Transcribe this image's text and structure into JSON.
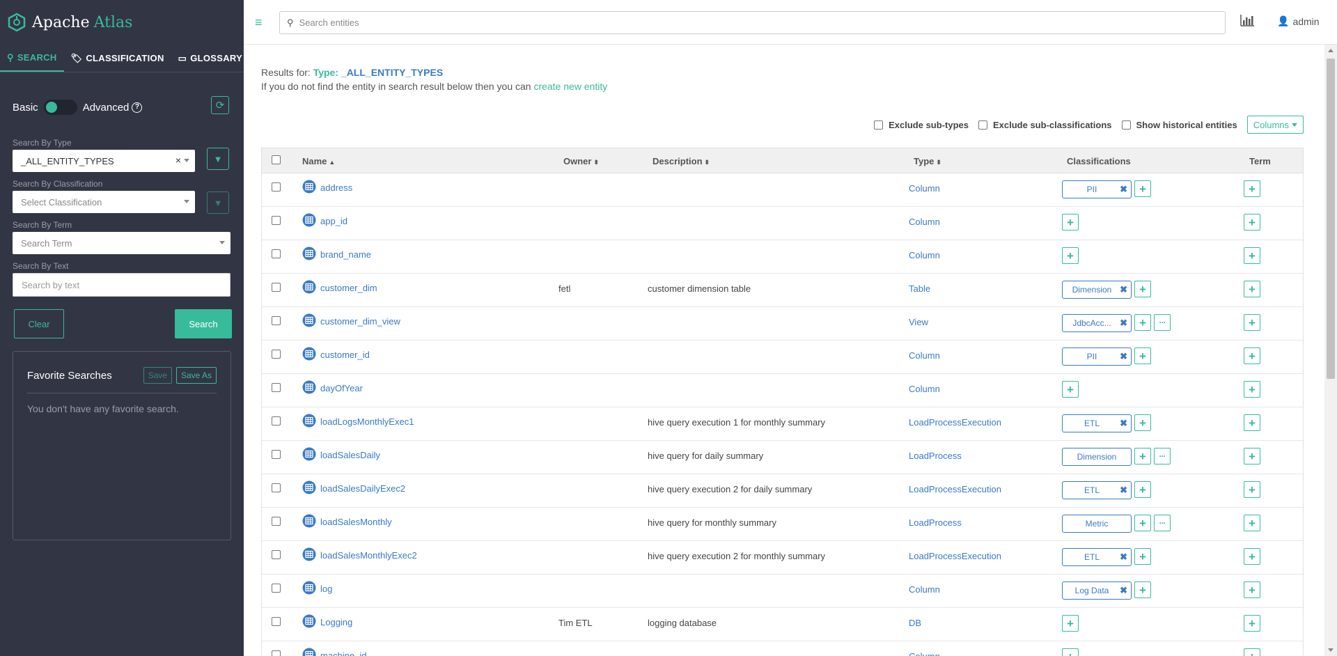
{
  "brand": {
    "name": "Apache",
    "accent": "Atlas"
  },
  "nav": [
    {
      "label": "SEARCH",
      "icon": "search-icon",
      "active": true
    },
    {
      "label": "CLASSIFICATION",
      "icon": "tags-icon"
    },
    {
      "label": "GLOSSARY",
      "icon": "folder-open-icon"
    }
  ],
  "search_panel": {
    "toggle_left": "Basic",
    "toggle_right": "Advanced",
    "type_label": "Search By Type",
    "type_value": "_ALL_ENTITY_TYPES",
    "type_clear": "×",
    "classification_label": "Search By Classification",
    "classification_placeholder": "Select Classification",
    "term_label": "Search By Term",
    "term_placeholder": "Search Term",
    "text_label": "Search By Text",
    "text_placeholder": "Search by text",
    "clear_button": "Clear",
    "search_button": "Search"
  },
  "favorites": {
    "title": "Favorite Searches",
    "save": "Save",
    "save_as": "Save As",
    "empty": "You don't have any favorite search."
  },
  "header": {
    "search_placeholder": "Search entities",
    "user": "admin"
  },
  "results": {
    "prefix": "Results for:",
    "type_prefix": "Type:",
    "type_name": "_ALL_ENTITY_TYPES",
    "hint": "If you do not find the entity in search result below then you can",
    "hint_link": "create new entity"
  },
  "options": {
    "exclude_subtypes": "Exclude sub-types",
    "exclude_subclass": "Exclude sub-classifications",
    "show_historical": "Show historical entities",
    "columns": "Columns"
  },
  "columns": {
    "name": "Name",
    "name_sort": "▲",
    "owner": "Owner",
    "description": "Description",
    "type": "Type",
    "classifications": "Classifications",
    "term": "Term",
    "sortable": "⬍"
  },
  "rows": [
    {
      "name": "address",
      "owner": "",
      "description": "",
      "type": "Column",
      "tag": "PII",
      "removable": true,
      "more": false
    },
    {
      "name": "app_id",
      "owner": "",
      "description": "",
      "type": "Column",
      "tag": "",
      "removable": false,
      "more": false
    },
    {
      "name": "brand_name",
      "owner": "",
      "description": "",
      "type": "Column",
      "tag": "",
      "removable": false,
      "more": false
    },
    {
      "name": "customer_dim",
      "owner": "fetl",
      "description": "customer dimension table",
      "type": "Table",
      "tag": "Dimension",
      "removable": true,
      "more": false
    },
    {
      "name": "customer_dim_view",
      "owner": "",
      "description": "",
      "type": "View",
      "tag": "JdbcAcc...",
      "removable": true,
      "more": true
    },
    {
      "name": "customer_id",
      "owner": "",
      "description": "",
      "type": "Column",
      "tag": "PII",
      "removable": true,
      "more": false
    },
    {
      "name": "dayOfYear",
      "owner": "",
      "description": "",
      "type": "Column",
      "tag": "",
      "removable": false,
      "more": false
    },
    {
      "name": "loadLogsMonthlyExec1",
      "owner": "",
      "description": "hive query execution 1 for monthly summary",
      "type": "LoadProcessExecution",
      "tag": "ETL",
      "removable": true,
      "more": false
    },
    {
      "name": "loadSalesDaily",
      "owner": "",
      "description": "hive query for daily summary",
      "type": "LoadProcess",
      "tag": "Dimension",
      "removable": false,
      "more": true
    },
    {
      "name": "loadSalesDailyExec2",
      "owner": "",
      "description": "hive query execution 2 for daily summary",
      "type": "LoadProcessExecution",
      "tag": "ETL",
      "removable": true,
      "more": false
    },
    {
      "name": "loadSalesMonthly",
      "owner": "",
      "description": "hive query for monthly summary",
      "type": "LoadProcess",
      "tag": "Metric",
      "removable": false,
      "more": true
    },
    {
      "name": "loadSalesMonthlyExec2",
      "owner": "",
      "description": "hive query execution 2 for monthly summary",
      "type": "LoadProcessExecution",
      "tag": "ETL",
      "removable": true,
      "more": false
    },
    {
      "name": "log",
      "owner": "",
      "description": "",
      "type": "Column",
      "tag": "Log Data",
      "removable": true,
      "more": false
    },
    {
      "name": "Logging",
      "owner": "Tim ETL",
      "description": "logging database",
      "type": "DB",
      "tag": "",
      "removable": false,
      "more": false
    },
    {
      "name": "machine_id",
      "owner": "",
      "description": "",
      "type": "Column",
      "tag": "",
      "removable": false,
      "more": false
    }
  ],
  "colors": {
    "accent": "#38bb9b",
    "link": "#3a7ac4",
    "sidebar": "#323544"
  }
}
